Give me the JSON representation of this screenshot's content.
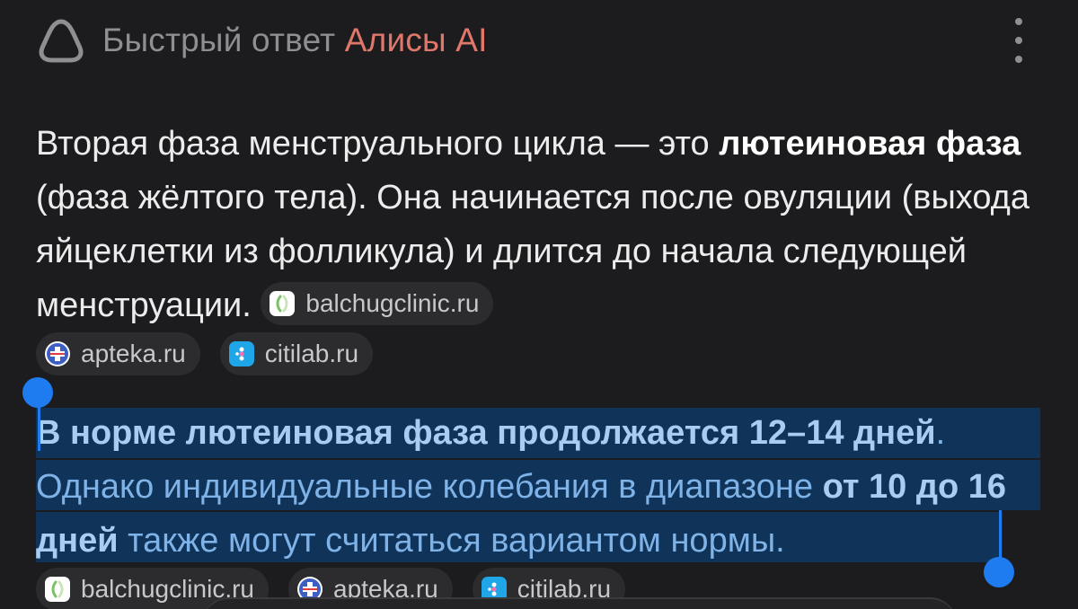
{
  "header": {
    "title_prefix": "Быстрый ответ ",
    "title_accent": "Алисы AI"
  },
  "paragraph1": {
    "t1": "Вторая фаза менструального цикла — это ",
    "b1": "лютеиновая фаза",
    "t2": " (фаза жёлтого тела). Она начинается после овуляции (выхода яйцеклетки из фолликула) и длится до начала следующей менструации. "
  },
  "sources1": [
    {
      "label": "balchugclinic.ru",
      "icon": "balchug-favicon"
    },
    {
      "label": "apteka.ru",
      "icon": "apteka-favicon"
    },
    {
      "label": "citilab.ru",
      "icon": "citilab-favicon"
    }
  ],
  "paragraph2": {
    "b1": "В норме лютеиновая фаза продолжается 12–14 дней",
    "t1": ". Однако индивидуальные колебания в диапазоне ",
    "b2": "от 10 до 16 дней",
    "t2": " также могут считаться вариантом нормы."
  },
  "sources2": [
    {
      "label": "balchugclinic.ru",
      "icon": "balchug-favicon"
    },
    {
      "label": "apteka.ru",
      "icon": "apteka-favicon"
    },
    {
      "label": "citilab.ru",
      "icon": "citilab-favicon"
    }
  ],
  "colors": {
    "background": "#1c1c1e",
    "accent": "#e0776b",
    "selection": "#0f3359",
    "handle": "#1e7bf0"
  }
}
